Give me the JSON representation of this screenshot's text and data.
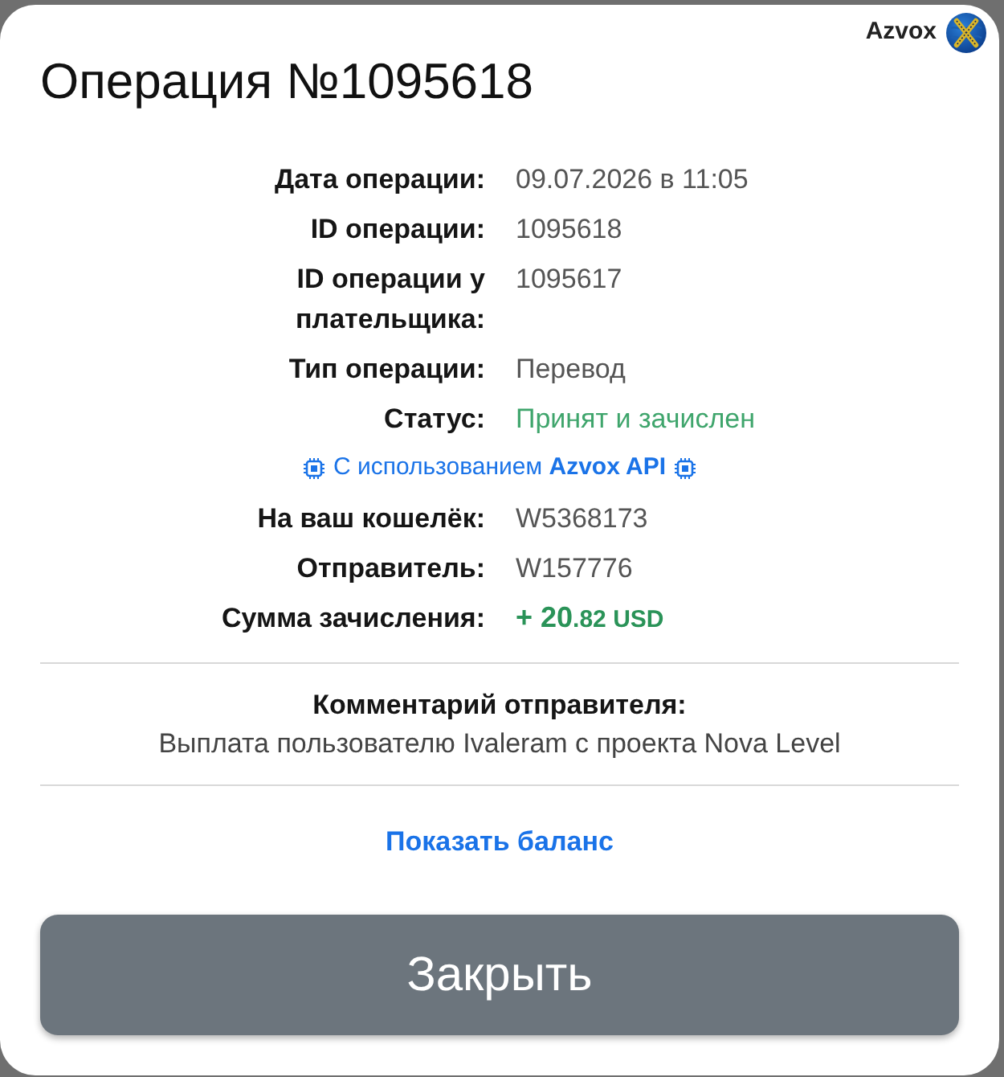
{
  "brand": {
    "name": "Azvox"
  },
  "title": "Операция №1095618",
  "rows": [
    {
      "kind": "field",
      "label": "Дата операции:",
      "value": "09.07.2026 в 11:05"
    },
    {
      "kind": "field",
      "label": "ID операции:",
      "value": "1095618"
    },
    {
      "kind": "field",
      "label": "ID операции у плательщика:",
      "value": "1095617"
    },
    {
      "kind": "field",
      "label": "Тип операции:",
      "value": "Перевод"
    },
    {
      "kind": "status",
      "label": "Статус:",
      "value": "Принят и зачислен"
    },
    {
      "kind": "note",
      "text": "С использованием **Azvox API**"
    },
    {
      "kind": "field",
      "label": "На ваш кошелёк:",
      "value": "W5368173"
    },
    {
      "kind": "field",
      "label": "Отправитель:",
      "value": "W157776"
    },
    {
      "kind": "amount",
      "label": "Сумма зачисления:",
      "value": "+ 20",
      "value_small": ".82 USD"
    }
  ],
  "comment": {
    "label": "Комментарий отправителя:",
    "text": "Выплата пользователю Ivaleram с проекта Nova Level"
  },
  "link": "Показать баланс",
  "button": "Закрыть"
}
